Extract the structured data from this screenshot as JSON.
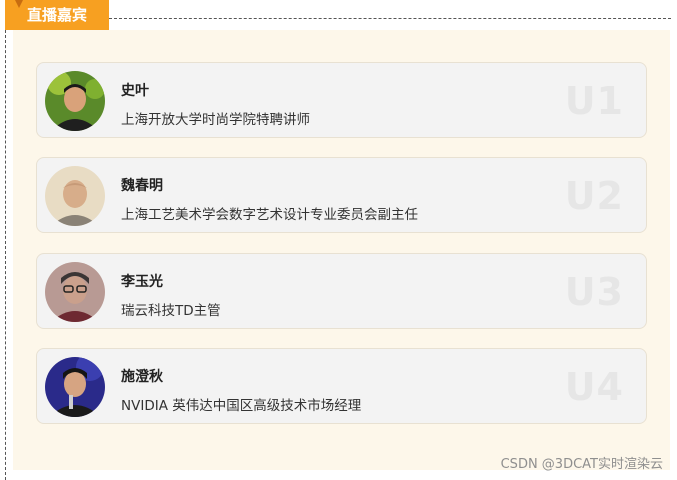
{
  "section": {
    "title": "直播嘉宾"
  },
  "guests": [
    {
      "name": "史叶",
      "title": "上海开放大学时尚学院特聘讲师",
      "index_label": "U1"
    },
    {
      "name": "魏春明",
      "title": "上海工艺美术学会数字艺术设计专业委员会副主任",
      "index_label": "U2"
    },
    {
      "name": "李玉光",
      "title": "瑞云科技TD主管",
      "index_label": "U3"
    },
    {
      "name": "施澄秋",
      "title": "NVIDIA 英伟达中国区高级技术市场经理",
      "index_label": "U4"
    }
  ],
  "watermark": "CSDN @3DCAT实时渲染云",
  "colors": {
    "accent": "#f7a021",
    "panel": "#fdf7ea",
    "card": "#f3f3f3"
  }
}
